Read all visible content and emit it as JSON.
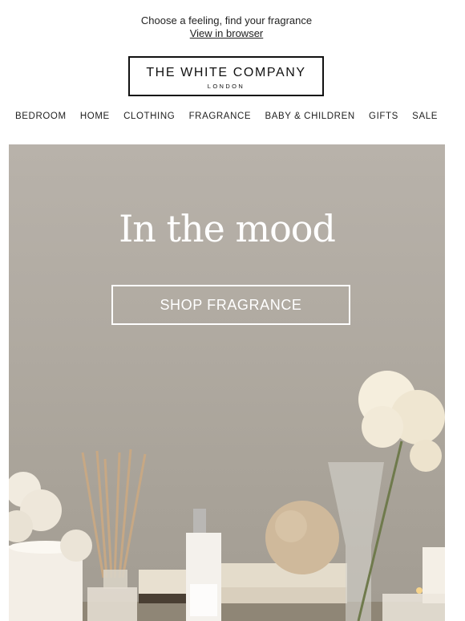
{
  "preheader": {
    "text": "Choose a feeling, find your fragrance",
    "view_link": "View in browser"
  },
  "logo": {
    "brand": "THE WHITE COMPANY",
    "city": "LONDON"
  },
  "nav": {
    "items": [
      "BEDROOM",
      "HOME",
      "CLOTHING",
      "FRAGRANCE",
      "BABY & CHILDREN",
      "GIFTS",
      "SALE"
    ]
  },
  "hero": {
    "title": "In the mood",
    "cta": "SHOP FRAGRANCE"
  },
  "colors": {
    "hero_bg": "#b0aaa1",
    "text": "#222222",
    "white": "#ffffff"
  }
}
